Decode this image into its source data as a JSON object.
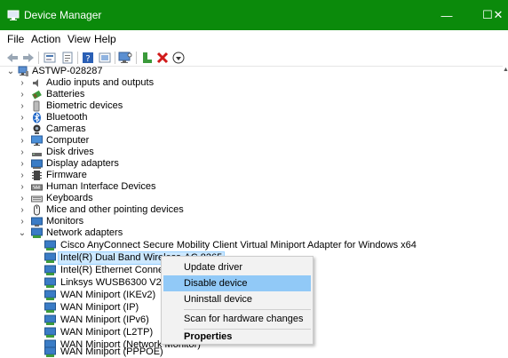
{
  "window": {
    "title": "Device Manager",
    "min_glyph": "—",
    "max_glyph": "☐",
    "close_glyph": "✕"
  },
  "menu": [
    "File",
    "Action",
    "View",
    "Help"
  ],
  "tree": {
    "root": "ASTWP-028287",
    "categories": [
      "Audio inputs and outputs",
      "Batteries",
      "Biometric devices",
      "Bluetooth",
      "Cameras",
      "Computer",
      "Disk drives",
      "Display adapters",
      "Firmware",
      "Human Interface Devices",
      "Keyboards",
      "Mice and other pointing devices",
      "Monitors",
      "Network adapters"
    ],
    "network_adapters": [
      "Cisco AnyConnect Secure Mobility Client Virtual Miniport Adapter for Windows x64",
      "Intel(R) Dual Band Wireless-AC 8265",
      "Intel(R) Ethernet Connection (",
      "Linksys WUSB6300 V2 #2",
      "WAN Miniport (IKEv2)",
      "WAN Miniport (IP)",
      "WAN Miniport (IPv6)",
      "WAN Miniport (L2TP)",
      "WAN Miniport (Network Monitor)",
      "WAN Miniport (PPPOE)"
    ]
  },
  "context_menu": {
    "update_driver": "Update driver",
    "disable_device": "Disable device",
    "uninstall_device": "Uninstall device",
    "scan": "Scan for hardware changes",
    "properties": "Properties"
  },
  "colors": {
    "titlebar": "#0b8a0b",
    "selection": "#cce8ff",
    "context_highlight": "#91c9f7"
  }
}
